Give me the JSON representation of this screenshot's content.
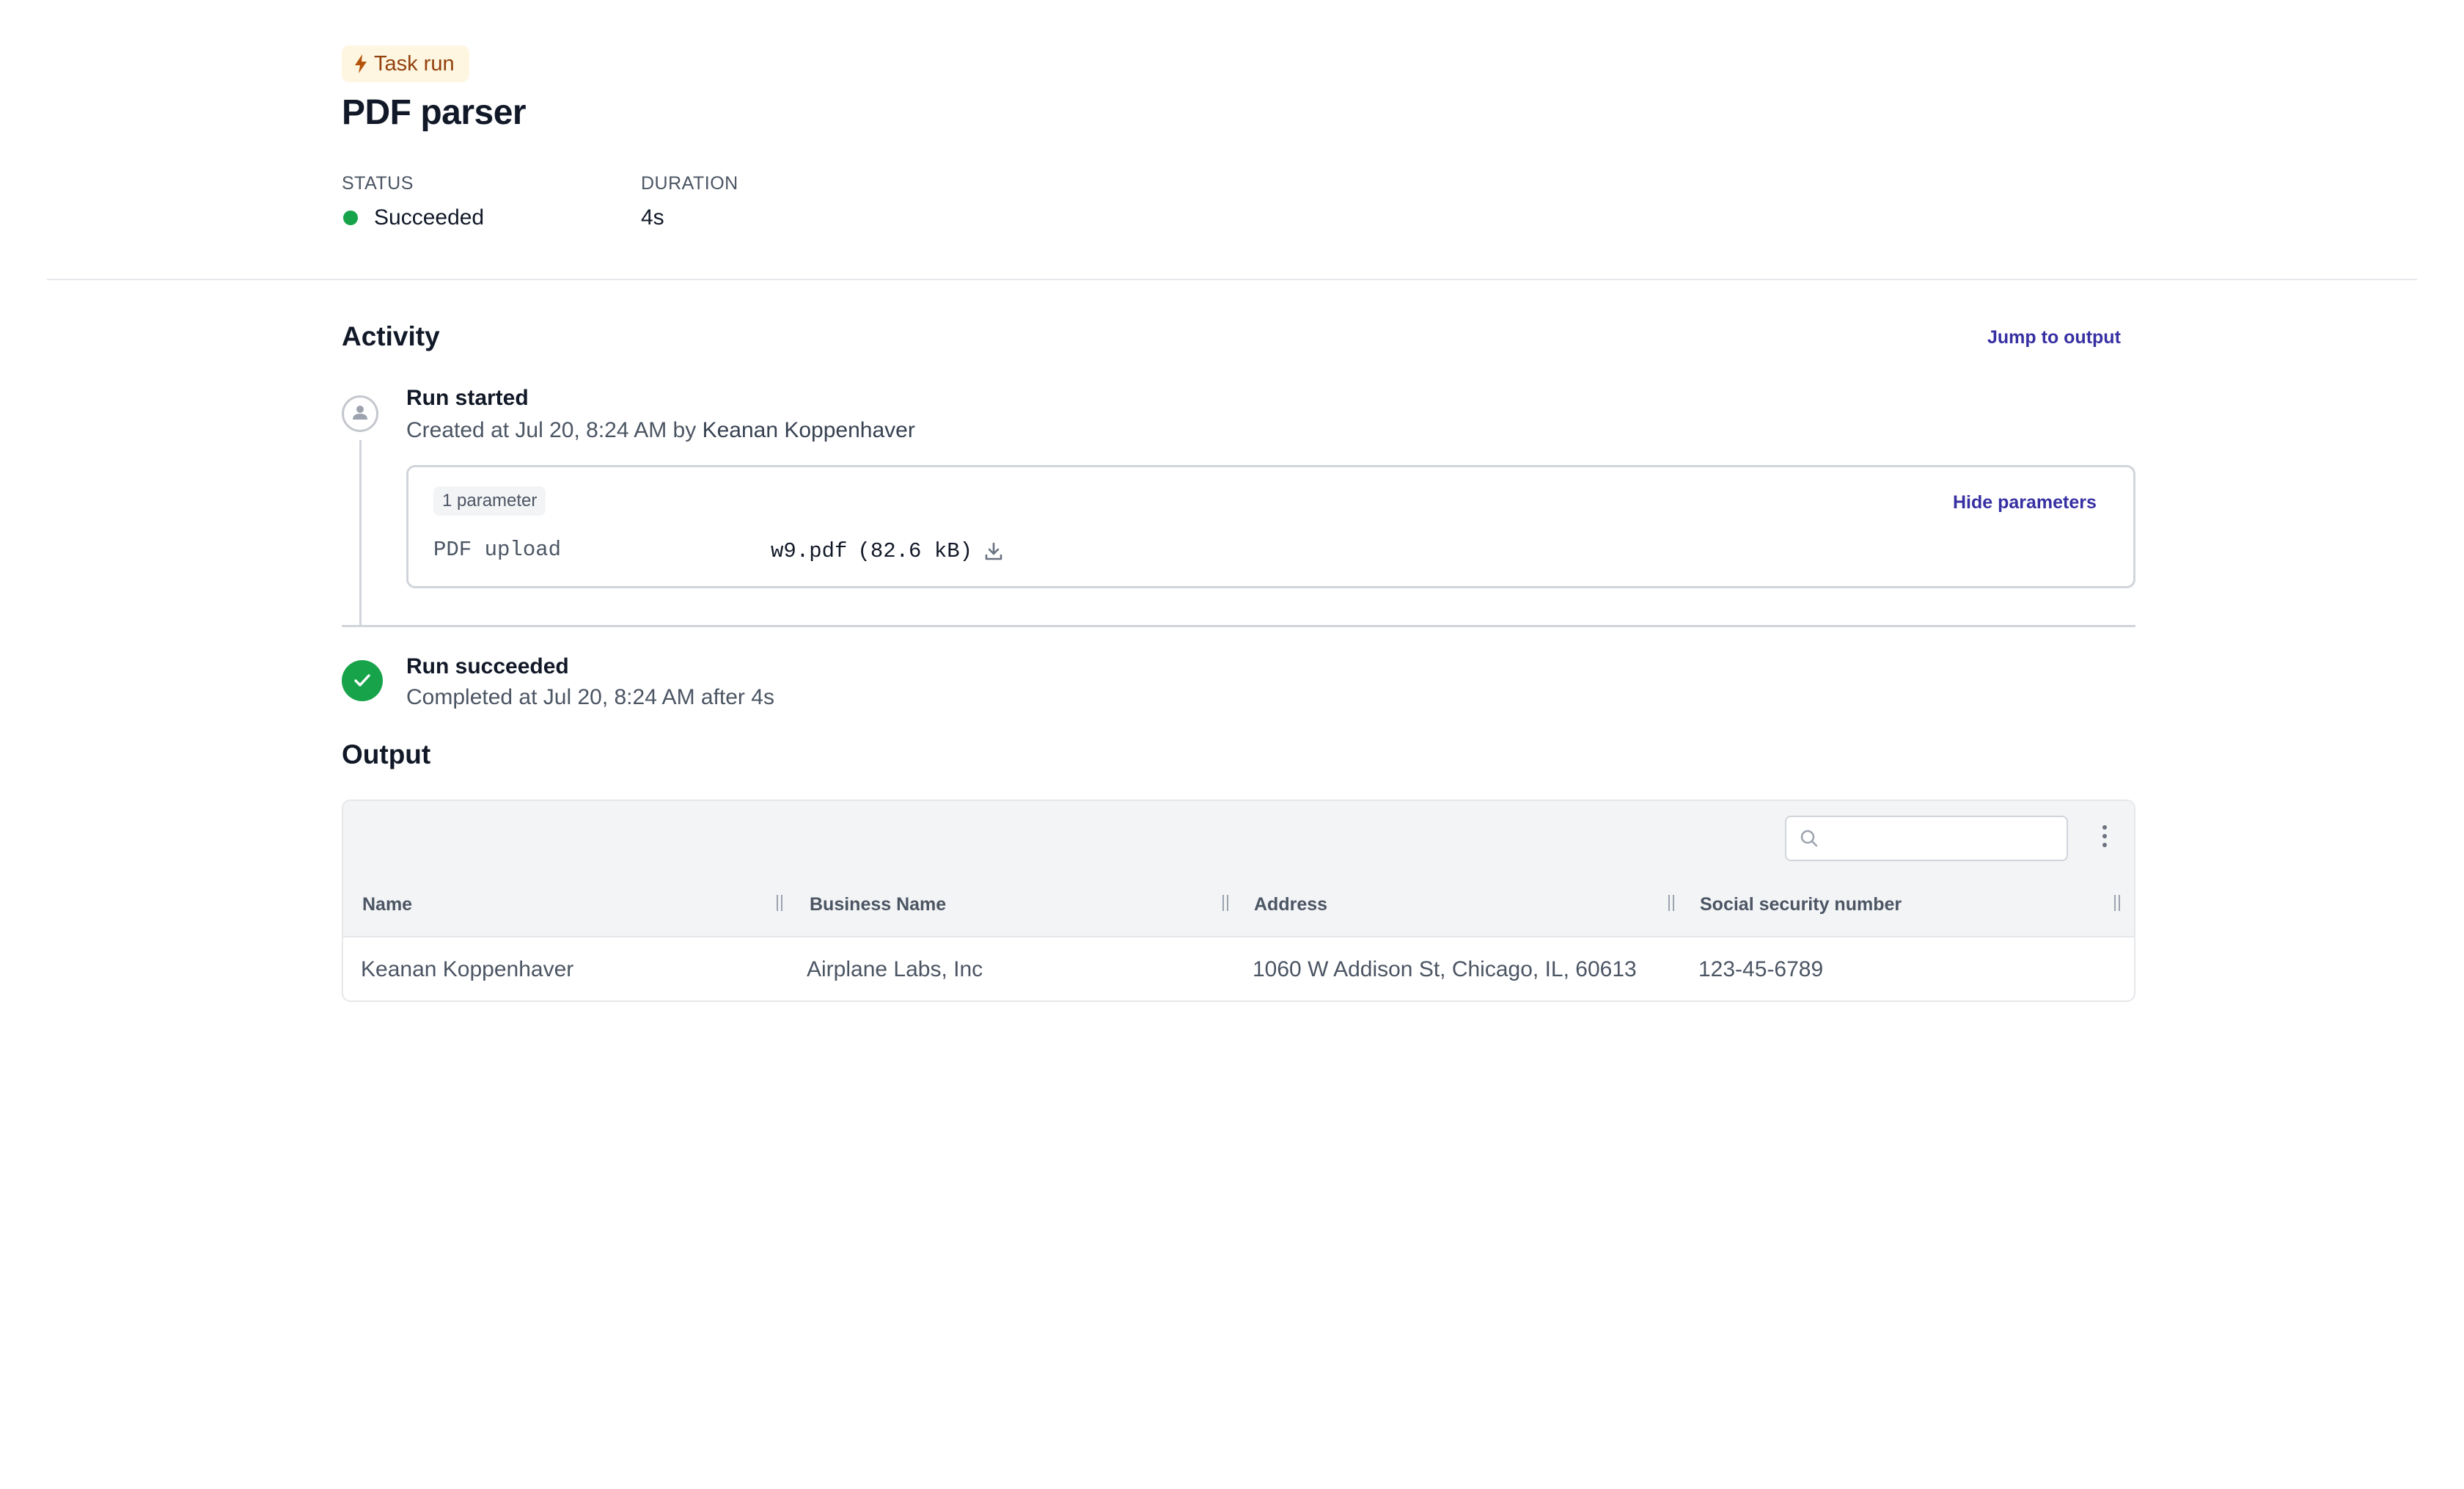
{
  "header": {
    "badge_label": "Task run",
    "title": "PDF parser",
    "status_label": "STATUS",
    "status_value": "Succeeded",
    "duration_label": "DURATION",
    "duration_value": "4s"
  },
  "colors": {
    "success": "#16a34a",
    "link": "#3730a3",
    "badge_bg": "#fef6e0",
    "badge_text": "#92400e"
  },
  "activity": {
    "title": "Activity",
    "jump_link": "Jump to output",
    "run_started": {
      "title": "Run started",
      "prefix": "Created at Jul 20, 8:24 AM by",
      "user": "Keanan Koppenhaver"
    },
    "parameters": {
      "count_label": "1 parameter",
      "hide_link": "Hide parameters",
      "items": [
        {
          "name": "PDF upload",
          "file": "w9.pdf",
          "size": "(82.6 kB)"
        }
      ]
    },
    "run_succeeded": {
      "title": "Run succeeded",
      "subtitle": "Completed at Jul 20, 8:24 AM after 4s"
    }
  },
  "output": {
    "title": "Output",
    "search_placeholder": "",
    "columns": [
      "Name",
      "Business Name",
      "Address",
      "Social security number"
    ],
    "rows": [
      [
        "Keanan Koppenhaver",
        "Airplane Labs, Inc",
        "1060 W Addison St, Chicago, IL, 60613",
        "123-45-6789"
      ]
    ]
  }
}
